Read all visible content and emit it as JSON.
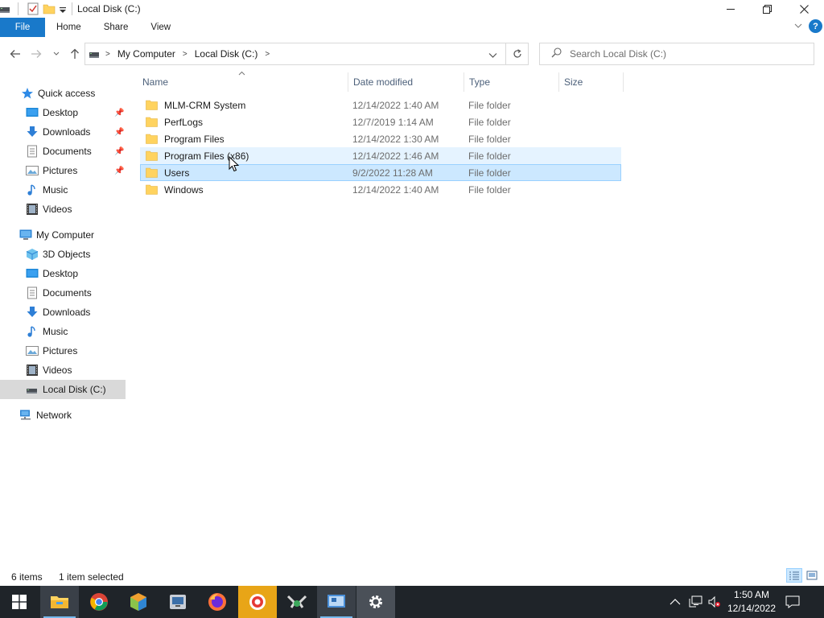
{
  "window": {
    "title": "Local Disk (C:)",
    "controls": {
      "minimize": "—",
      "maximize": "❐",
      "close": "✕"
    }
  },
  "ribbon": {
    "tabs": [
      {
        "label": "File"
      },
      {
        "label": "Home"
      },
      {
        "label": "Share"
      },
      {
        "label": "View"
      }
    ],
    "help": "?"
  },
  "address": {
    "crumbs": [
      "My Computer",
      "Local Disk (C:)"
    ],
    "search_placeholder": "Search Local Disk (C:)"
  },
  "nav": {
    "quick_access": "Quick access",
    "quick_items": [
      {
        "label": "Desktop",
        "icon": "desktop-icon",
        "pinned": true
      },
      {
        "label": "Downloads",
        "icon": "download-icon",
        "pinned": true
      },
      {
        "label": "Documents",
        "icon": "documents-icon",
        "pinned": true
      },
      {
        "label": "Pictures",
        "icon": "pictures-icon",
        "pinned": true
      },
      {
        "label": "Music",
        "icon": "music-icon",
        "pinned": false
      },
      {
        "label": "Videos",
        "icon": "videos-icon",
        "pinned": false
      }
    ],
    "my_computer": "My Computer",
    "computer_items": [
      {
        "label": "3D Objects",
        "icon": "3d-objects-icon"
      },
      {
        "label": "Desktop",
        "icon": "desktop-icon"
      },
      {
        "label": "Documents",
        "icon": "documents-icon"
      },
      {
        "label": "Downloads",
        "icon": "download-icon"
      },
      {
        "label": "Music",
        "icon": "music-icon"
      },
      {
        "label": "Pictures",
        "icon": "pictures-icon"
      },
      {
        "label": "Videos",
        "icon": "videos-icon"
      },
      {
        "label": "Local Disk (C:)",
        "icon": "drive-icon"
      }
    ],
    "network": "Network"
  },
  "columns": {
    "name": "Name",
    "date": "Date modified",
    "type": "Type",
    "size": "Size"
  },
  "files": [
    {
      "name": "MLM-CRM System",
      "date": "12/14/2022 1:40 AM",
      "type": "File folder",
      "size": ""
    },
    {
      "name": "PerfLogs",
      "date": "12/7/2019 1:14 AM",
      "type": "File folder",
      "size": ""
    },
    {
      "name": "Program Files",
      "date": "12/14/2022 1:30 AM",
      "type": "File folder",
      "size": ""
    },
    {
      "name": "Program Files (x86)",
      "date": "12/14/2022 1:46 AM",
      "type": "File folder",
      "size": ""
    },
    {
      "name": "Users",
      "date": "9/2/2022 11:28 AM",
      "type": "File folder",
      "size": ""
    },
    {
      "name": "Windows",
      "date": "12/14/2022 1:40 AM",
      "type": "File folder",
      "size": ""
    }
  ],
  "status": {
    "item_count": "6 items",
    "selection": "1 item selected"
  },
  "taskbar": {
    "clock_time": "1:50 AM",
    "clock_date": "12/14/2022"
  },
  "colors": {
    "accent": "#1979ca",
    "selection": "#cce8ff",
    "selection_border": "#99d1ff",
    "hover": "#e5f3ff",
    "folder": "#ffd35f",
    "taskbar": "#1f2429"
  }
}
